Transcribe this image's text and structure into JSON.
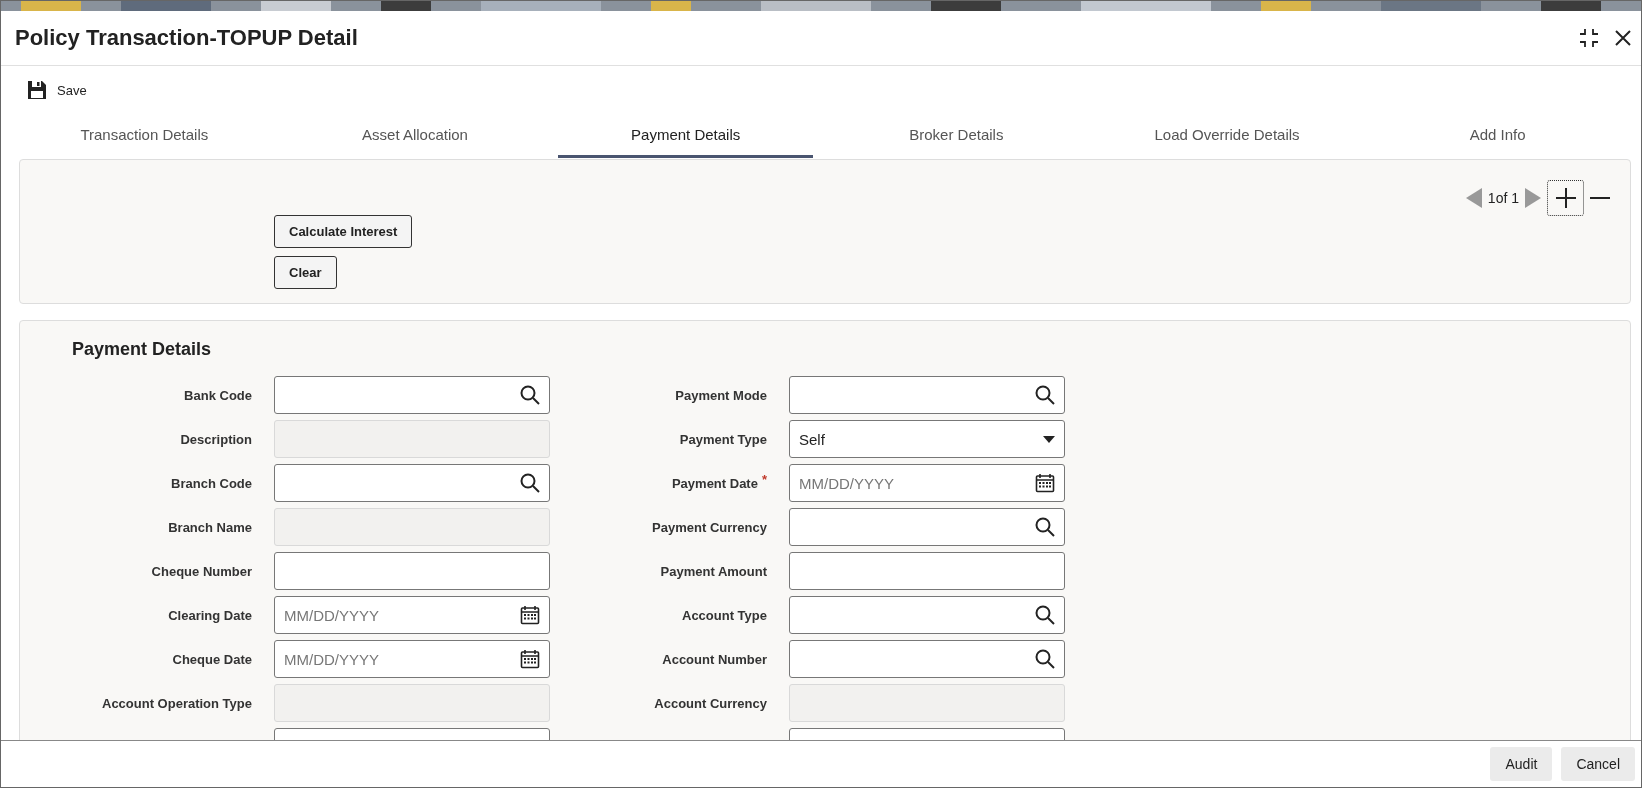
{
  "window": {
    "title": "Policy Transaction-TOPUP Detail"
  },
  "toolbar": {
    "save": "Save"
  },
  "tabs": [
    {
      "label": "Transaction Details",
      "selected": false
    },
    {
      "label": "Asset Allocation",
      "selected": false
    },
    {
      "label": "Payment Details",
      "selected": true
    },
    {
      "label": "Broker Details",
      "selected": false
    },
    {
      "label": "Load Override Details",
      "selected": false
    },
    {
      "label": "Add Info",
      "selected": false
    }
  ],
  "record_nav": {
    "label": "1of 1"
  },
  "actions": [
    "Calculate Interest",
    "Clear"
  ],
  "section": {
    "title": "Payment Details",
    "fields": [
      {
        "label": "Bank Code",
        "kind": "lookup"
      },
      {
        "label": "Payment Mode",
        "kind": "lookup"
      },
      {
        "label": "Description",
        "kind": "readonly"
      },
      {
        "label": "Payment Type",
        "kind": "select",
        "value": "Self"
      },
      {
        "label": "Branch Code",
        "kind": "lookup"
      },
      {
        "label": "Payment Date",
        "kind": "date",
        "placeholder": "MM/DD/YYYY",
        "required_mark": "*"
      },
      {
        "label": "Branch Name",
        "kind": "readonly"
      },
      {
        "label": "Payment Currency",
        "kind": "lookup"
      },
      {
        "label": "Cheque Number",
        "kind": "text"
      },
      {
        "label": "Payment Amount",
        "kind": "text"
      },
      {
        "label": "Clearing Date",
        "kind": "date",
        "placeholder": "MM/DD/YYYY"
      },
      {
        "label": "Account Type",
        "kind": "lookup"
      },
      {
        "label": "Cheque Date",
        "kind": "date",
        "placeholder": "MM/DD/YYYY"
      },
      {
        "label": "Account Number",
        "kind": "lookup"
      },
      {
        "label": "Account Operation Type",
        "kind": "readonly"
      },
      {
        "label": "Account Currency",
        "kind": "readonly"
      },
      {
        "kind": "text"
      },
      {
        "kind": "text"
      }
    ]
  },
  "footer_buttons": [
    "Audit",
    "Cancel"
  ]
}
